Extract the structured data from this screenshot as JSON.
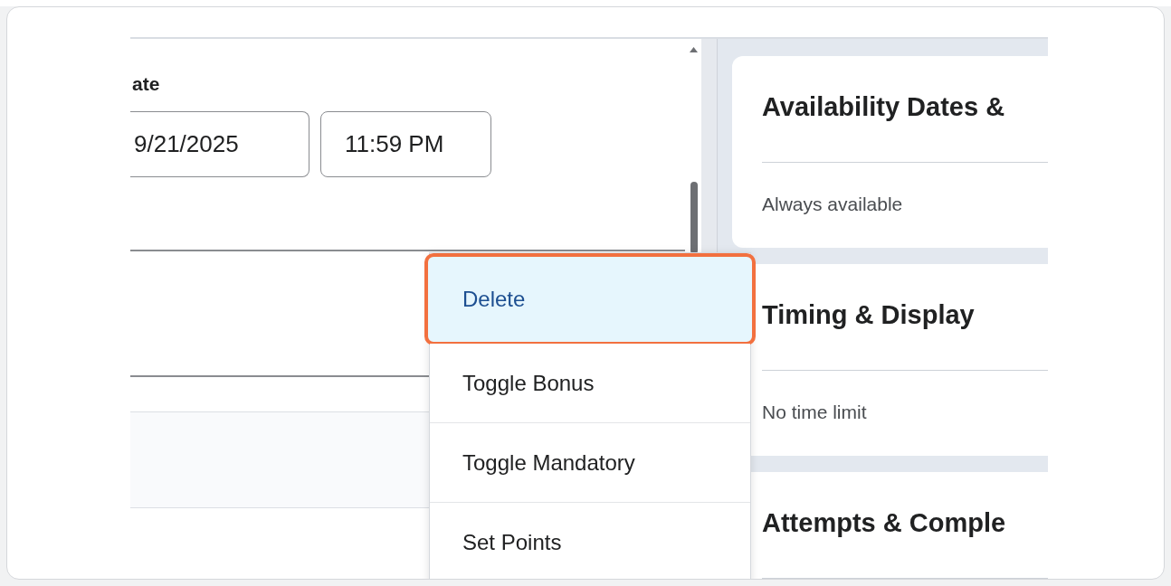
{
  "left_panel": {
    "date_label": "ate",
    "date_value": "9/21/2025",
    "time_value": "11:59 PM"
  },
  "context_menu": {
    "items": [
      {
        "label": "Delete",
        "selected": true
      },
      {
        "label": "Toggle Bonus",
        "selected": false
      },
      {
        "label": "Toggle Mandatory",
        "selected": false
      },
      {
        "label": "Set Points",
        "selected": false
      }
    ]
  },
  "right_panel": {
    "cards": [
      {
        "title": "Availability Dates &",
        "summary": "Always available"
      },
      {
        "title": "Timing & Display",
        "summary": "No time limit"
      },
      {
        "title": "Attempts & Comple"
      }
    ]
  }
}
